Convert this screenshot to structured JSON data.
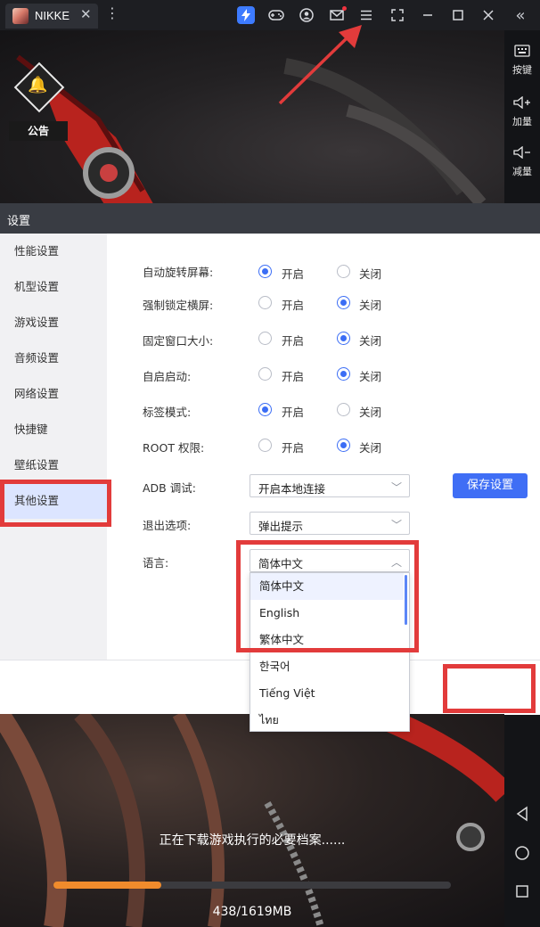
{
  "window": {
    "tab_title": "NIKKE",
    "tab_close": "✕",
    "more": "⋮",
    "collapse": "«"
  },
  "toolbar_icons": [
    "bolt-icon",
    "gamepad-icon",
    "user-icon",
    "mail-icon",
    "menu-icon",
    "screenshot-icon",
    "minimize-icon",
    "maximize-icon",
    "close-icon"
  ],
  "game": {
    "notice_label": "公告",
    "download_text": "正在下载游戏执行的必要档案......",
    "progress_text": "438/1619MB",
    "progress_fraction": 0.2705
  },
  "sidebar_right": {
    "items": [
      {
        "icon": "keyboard-icon",
        "label": "按键"
      },
      {
        "icon": "volume-up-icon",
        "label": "加量"
      },
      {
        "icon": "volume-down-icon",
        "label": "减量"
      }
    ],
    "nav": [
      "back-icon",
      "home-icon",
      "recent-apps-icon"
    ]
  },
  "settings": {
    "title": "设置",
    "nav": [
      {
        "label": "性能设置",
        "active": false
      },
      {
        "label": "机型设置",
        "active": false
      },
      {
        "label": "游戏设置",
        "active": false
      },
      {
        "label": "音频设置",
        "active": false
      },
      {
        "label": "网络设置",
        "active": false
      },
      {
        "label": "快捷键",
        "active": false
      },
      {
        "label": "壁纸设置",
        "active": false
      },
      {
        "label": "其他设置",
        "active": true
      }
    ],
    "on_label": "开启",
    "off_label": "关闭",
    "toggles": [
      {
        "label": "自动旋转屏幕:",
        "value": "on"
      },
      {
        "label": "强制锁定横屏:",
        "value": "off"
      },
      {
        "label": "固定窗口大小:",
        "value": "off"
      },
      {
        "label": "自启启动:",
        "value": "off"
      },
      {
        "label": "标签模式:",
        "value": "on"
      },
      {
        "label": "ROOT 权限:",
        "value": "off"
      }
    ],
    "adb": {
      "label": "ADB 调试:",
      "value": "开启本地连接"
    },
    "exit": {
      "label": "退出选项:",
      "value": "弹出提示"
    },
    "language": {
      "label": "语言:",
      "value": "简体中文",
      "options": [
        "简体中文",
        "English",
        "繁体中文",
        "한국어",
        "Tiếng Việt",
        "ไทย"
      ]
    },
    "save_label": "保存设置"
  },
  "colors": {
    "accent": "#3f6ef5",
    "highlight": "#e23b3b",
    "progress": "#f08b2c"
  }
}
